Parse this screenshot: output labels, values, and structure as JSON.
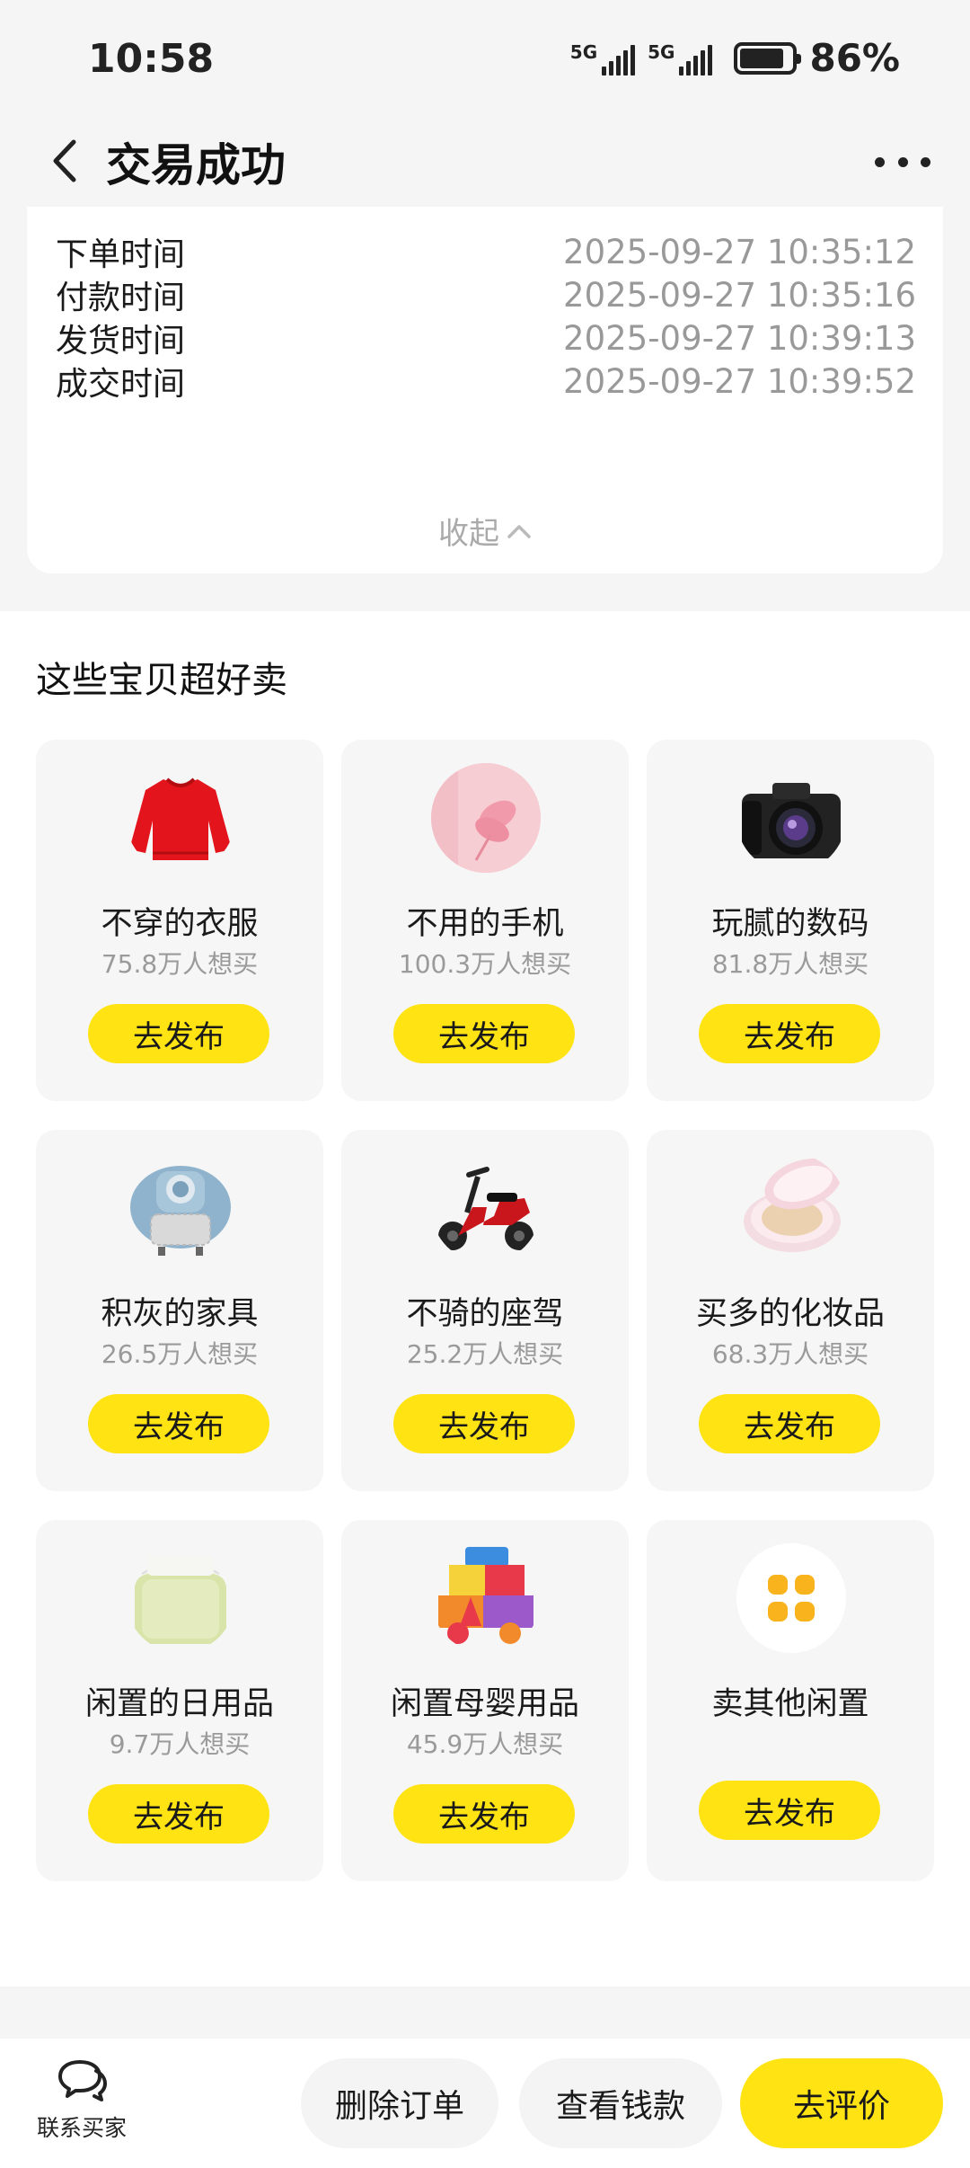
{
  "status_bar": {
    "time": "10:58",
    "signal1": "5G",
    "signal2": "5G",
    "battery": "86%",
    "battery_level": 0.86
  },
  "header": {
    "title": "交易成功",
    "back_icon": "chevron-left-icon",
    "more_icon": "more-dots-icon"
  },
  "order_info": {
    "rows": [
      {
        "label": "下单时间",
        "value": "2025-09-27 10:35:12"
      },
      {
        "label": "付款时间",
        "value": "2025-09-27 10:35:16"
      },
      {
        "label": "发货时间",
        "value": "2025-09-27 10:39:13"
      },
      {
        "label": "成交时间",
        "value": "2025-09-27 10:39:52"
      }
    ],
    "collapse_label": "收起"
  },
  "recommend": {
    "title": "这些宝贝超好卖",
    "items": [
      {
        "name": "不穿的衣服",
        "count": "75.8万人想买",
        "button": "去发布",
        "icon": "sweater-icon"
      },
      {
        "name": "不用的手机",
        "count": "100.3万人想买",
        "button": "去发布",
        "icon": "phone-icon"
      },
      {
        "name": "玩腻的数码",
        "count": "81.8万人想买",
        "button": "去发布",
        "icon": "camera-icon"
      },
      {
        "name": "积灰的家具",
        "count": "26.5万人想买",
        "button": "去发布",
        "icon": "armchair-icon"
      },
      {
        "name": "不骑的座驾",
        "count": "25.2万人想买",
        "button": "去发布",
        "icon": "scooter-icon"
      },
      {
        "name": "买多的化妆品",
        "count": "68.3万人想买",
        "button": "去发布",
        "icon": "cushion-compact-icon"
      },
      {
        "name": "闲置的日用品",
        "count": "9.7万人想买",
        "button": "去发布",
        "icon": "storage-box-icon"
      },
      {
        "name": "闲置母婴用品",
        "count": "45.9万人想买",
        "button": "去发布",
        "icon": "toy-blocks-icon"
      },
      {
        "name": "卖其他闲置",
        "count": "",
        "button": "去发布",
        "icon": "grid-dots-icon"
      }
    ]
  },
  "bottom_bar": {
    "contact_label": "联系买家",
    "delete_label": "删除订单",
    "view_label": "查看钱款",
    "review_label": "去评价"
  },
  "colors": {
    "accent": "#ffe313",
    "background": "#f5f5f5",
    "muted_text": "#999999"
  }
}
